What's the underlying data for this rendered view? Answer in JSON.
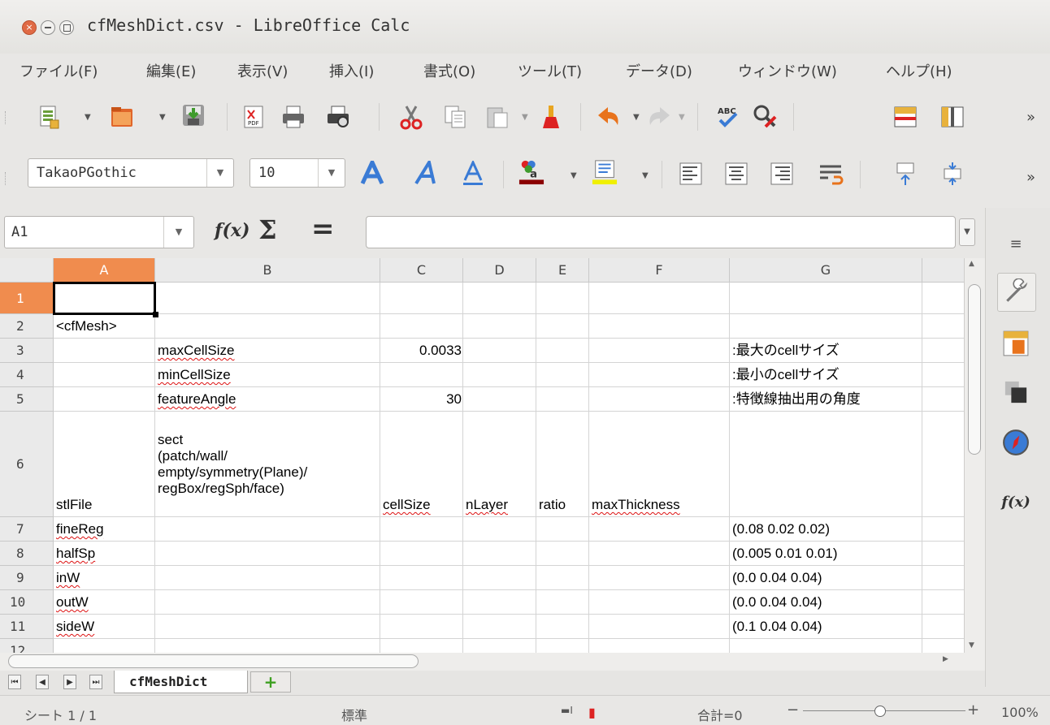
{
  "window": {
    "title": "cfMeshDict.csv - LibreOffice Calc"
  },
  "menu": [
    "ファイル(F)",
    "編集(E)",
    "表示(V)",
    "挿入(I)",
    "書式(O)",
    "ツール(T)",
    "データ(D)",
    "ウィンドウ(W)",
    "ヘルプ(H)"
  ],
  "toolbar1": {
    "icons": [
      "new-document-icon",
      "template-icon",
      "save-icon",
      "export-pdf-icon",
      "print-icon",
      "print-preview-icon",
      "cut-icon",
      "copy-icon",
      "paste-icon",
      "clone-formatting-icon",
      "undo-icon",
      "redo-icon",
      "spellcheck-icon",
      "find-replace-icon",
      "freeze-rows-icon",
      "freeze-columns-icon"
    ],
    "more": "»"
  },
  "toolbar2": {
    "font_name": "TakaoPGothic",
    "font_size": "10",
    "more": "»"
  },
  "formula": {
    "name_box": "A1",
    "fx": "f(x)",
    "sum": "Σ",
    "equals": "=",
    "content": ""
  },
  "grid": {
    "columns": [
      "A",
      "B",
      "C",
      "D",
      "E",
      "F",
      "G"
    ],
    "rows": [
      "1",
      "2",
      "3",
      "4",
      "5",
      "6",
      "7",
      "8",
      "9",
      "10",
      "11",
      "12"
    ],
    "selected_cell": "A1",
    "cells": {
      "A2": "<cfMesh>",
      "B3": "maxCellSize",
      "C3": "0.0033",
      "G3": ":最大のcellサイズ",
      "B4": "minCellSize",
      "G4": ":最小のcellサイズ",
      "B5": "featureAngle",
      "C5": "30",
      "G5": ":特徴線抽出用の角度",
      "A6": "stlFile",
      "B6": "sect\n(patch/wall/\nempty/symmetry(Plane)/\nregBox/regSph/face)",
      "C6": "cellSize",
      "D6": "nLayer",
      "E6": "ratio",
      "F6": "maxThickness",
      "A7": "fineReg",
      "G7": "(0.08 0.02 0.02)",
      "A8": "halfSp",
      "G8": "(0.005 0.01 0.01)",
      "A9": "inW",
      "G9": "(0.0 0.04 0.04)",
      "A10": "outW",
      "G10": "(0.0 0.04 0.04)",
      "A11": "sideW",
      "G11": "(0.1 0.04 0.04)"
    }
  },
  "sheets": {
    "active": "cfMeshDict",
    "add": "+"
  },
  "status": {
    "sheet": "シート 1 / 1",
    "style": "標準",
    "sum": "合計=0",
    "zoom": "100%"
  },
  "colors": {
    "selected_header": "#f08c4e",
    "close_button": "#e06a45"
  }
}
